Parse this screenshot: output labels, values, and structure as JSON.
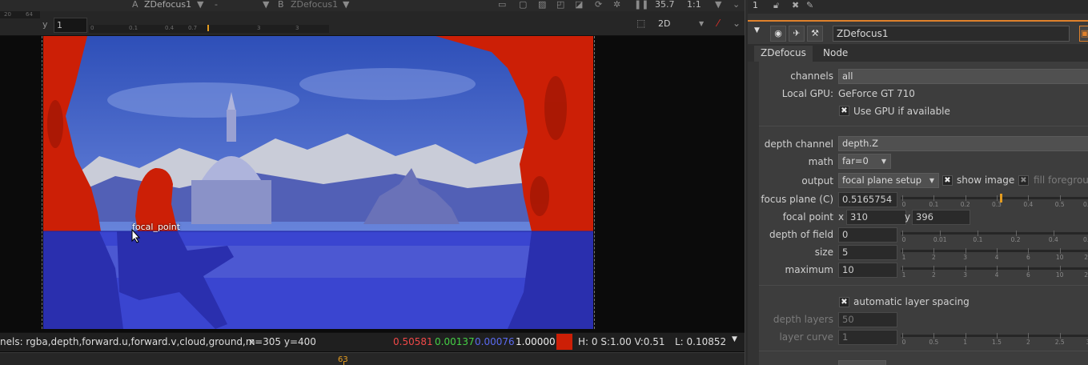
{
  "viewer": {
    "top_bar": {
      "a_label": "A",
      "a_input": "ZDefocus1",
      "a_op": "-",
      "b_label": "B",
      "b_input": "ZDefocus1",
      "zoom_value": "35.7",
      "scale": "1:1"
    },
    "row2": {
      "ruler_left_labels": [
        "20",
        "64"
      ],
      "y_label": "y",
      "y_value": "1",
      "ruler_labels": [
        "0",
        "0.1",
        "0.4",
        "0.7",
        "3",
        "3"
      ],
      "view_mode": "2D"
    },
    "image": {
      "mountain_color": "#c9ccd8",
      "sky_top_color": "#2e4fb8",
      "foreground_color": "#3a45d0",
      "in_focus_color": "#cc1f06"
    },
    "focal_point_label": "focal_point",
    "status": {
      "channels_text": "nels: rgba,depth,forward.u,forward.v,cloud,ground,m",
      "coords": "x=305 y=400",
      "r": "0.50581",
      "g": "0.00137",
      "b": "0.00076",
      "a": "1.00000",
      "swatch_color": "#cc1f06",
      "hsv": "H:   0 S:1.00 V:0.51",
      "lum": "L:  0.10852"
    },
    "timeline_frame": "63"
  },
  "panel": {
    "top_count": "1",
    "node_name": "ZDefocus1",
    "tabs": [
      "ZDefocus",
      "Node"
    ],
    "channels": {
      "label": "channels",
      "value": "all"
    },
    "local_gpu": {
      "label": "Local GPU:",
      "value": "GeForce GT 710"
    },
    "use_gpu": {
      "label": "Use GPU if available",
      "checked": true
    },
    "depth_channel": {
      "label": "depth channel",
      "value": "depth.Z"
    },
    "math": {
      "label": "math",
      "value": "far=0"
    },
    "output": {
      "label": "output",
      "value": "focal plane setup"
    },
    "show_image": {
      "label": "show image",
      "checked": true
    },
    "fill_foreground": {
      "label": "fill foregrou",
      "checked": true
    },
    "focus_plane": {
      "label": "focus plane (C)",
      "value": "0.5165754",
      "slider_labels": [
        "0",
        "0.1",
        "0.2",
        "0.3",
        "0.4",
        "0.5",
        "0.6"
      ],
      "fraction": 0.516
    },
    "focal_point": {
      "label": "focal point",
      "x_label": "x",
      "x": "310",
      "y_label": "y",
      "y": "396"
    },
    "depth_of_field": {
      "label": "depth of field",
      "value": "0",
      "slider_labels": [
        "0",
        "0.01",
        "0.1",
        "0.2",
        "0.4",
        "0.6"
      ]
    },
    "size": {
      "label": "size",
      "value": "5",
      "slider_labels": [
        "1",
        "2",
        "3",
        "4",
        "6",
        "10",
        "20"
      ]
    },
    "maximum": {
      "label": "maximum",
      "value": "10",
      "slider_labels": [
        "1",
        "2",
        "3",
        "4",
        "6",
        "10",
        "20"
      ]
    },
    "auto_layer_spacing": {
      "label": "automatic layer spacing",
      "checked": true
    },
    "depth_layers": {
      "label": "depth layers",
      "value": "50"
    },
    "layer_curve": {
      "label": "layer curve",
      "value": "1",
      "slider_labels": [
        "0",
        "0.5",
        "1",
        "1.5",
        "2",
        "2.5",
        "3"
      ]
    }
  }
}
